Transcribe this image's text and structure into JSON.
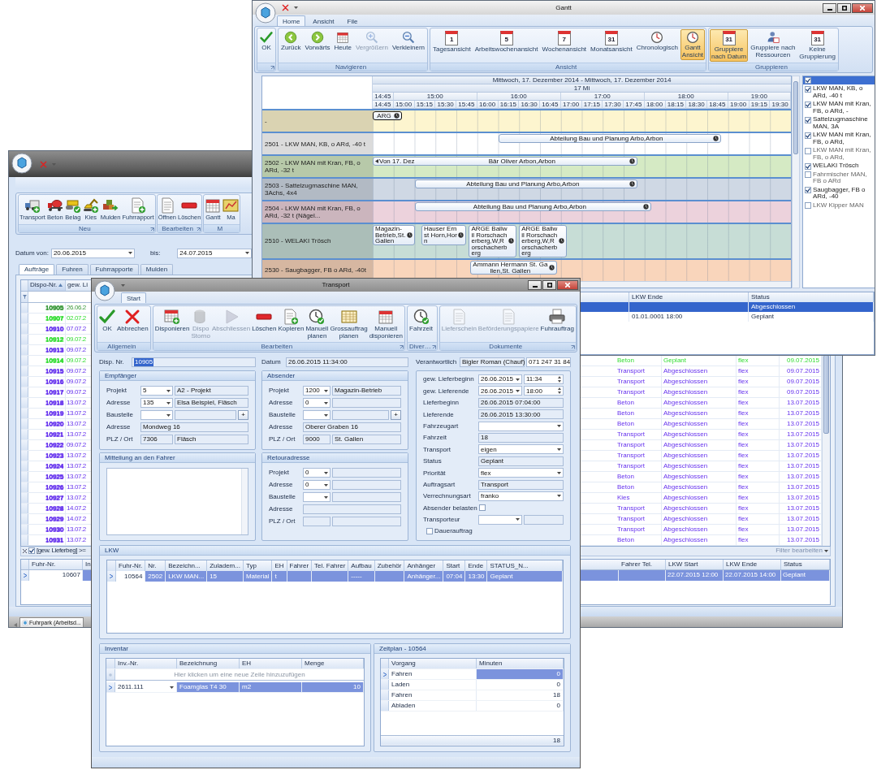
{
  "orders_window": {
    "ribbon_groups": [
      {
        "label": "Neu",
        "launcher": true,
        "buttons": [
          {
            "label": "Transport"
          },
          {
            "label": "Beton"
          },
          {
            "label": "Belag"
          },
          {
            "label": "Kies"
          },
          {
            "label": "Mulden"
          },
          {
            "label": "Fuhrrapport"
          }
        ]
      },
      {
        "label": "Bearbeiten",
        "launcher": true,
        "buttons": [
          {
            "label": "Öffnen"
          },
          {
            "label": "Löschen"
          }
        ]
      },
      {
        "label": "M",
        "launcher": false,
        "buttons": [
          {
            "label": "Gantt"
          },
          {
            "label": "Ma"
          }
        ]
      }
    ],
    "date_from": {
      "label": "Datum von:",
      "value": "20.06.2015"
    },
    "date_to": {
      "label": "bis:",
      "value": "24.07.2015"
    },
    "tabs": [
      {
        "label": "Aufträge",
        "selected": true
      },
      {
        "label": "Fuhren",
        "selected": false
      },
      {
        "label": "Fuhrrapporte",
        "selected": false
      },
      {
        "label": "Mulden",
        "selected": false
      }
    ],
    "orders_grid": {
      "columns": [
        {
          "label": "Dispo-Nr.",
          "sorted": true
        },
        {
          "label": "gew. Li",
          "sorted": false
        }
      ],
      "rows": [
        {
          "dispo_nr": "10905",
          "date": "26.06.2",
          "color": "#3c9a3c"
        },
        {
          "dispo_nr": "10907",
          "date": "02.07.2",
          "color": "#33dd33"
        },
        {
          "dispo_nr": "10910",
          "date": "07.07.2",
          "color": "#6633ee"
        },
        {
          "dispo_nr": "10912",
          "date": "09.07.2",
          "color": "#33dd33"
        },
        {
          "dispo_nr": "10913",
          "date": "09.07.2",
          "color": "#6633ee"
        },
        {
          "dispo_nr": "10914",
          "date": "09.07.2",
          "color": "#33dd33",
          "column_3": "Beton",
          "column_4": "Geplant",
          "column_5": "flex",
          "column_6": "09.07.2015"
        },
        {
          "dispo_nr": "10915",
          "date": "09.07.2",
          "color": "#6633ee",
          "column_3": "Transport",
          "column_4": "Abgeschlossen",
          "column_5": "flex",
          "column_6": "09.07.2015"
        },
        {
          "dispo_nr": "10916",
          "date": "09.07.2",
          "color": "#6633ee",
          "column_3": "Transport",
          "column_4": "Abgeschlossen",
          "column_5": "flex",
          "column_6": "09.07.2015"
        },
        {
          "dispo_nr": "10917",
          "date": "09.07.2",
          "color": "#6633ee",
          "column_3": "Transport",
          "column_4": "Abgeschlossen",
          "column_5": "flex",
          "column_6": "09.07.2015"
        },
        {
          "dispo_nr": "10918",
          "date": "13.07.2",
          "color": "#6633ee",
          "column_3": "Beton",
          "column_4": "Abgeschlossen",
          "column_5": "flex",
          "column_6": "13.07.2015"
        },
        {
          "dispo_nr": "10919",
          "date": "13.07.2",
          "color": "#6633ee",
          "column_3": "Beton",
          "column_4": "Abgeschlossen",
          "column_5": "flex",
          "column_6": "13.07.2015"
        },
        {
          "dispo_nr": "10920",
          "date": "13.07.2",
          "color": "#6633ee",
          "column_3": "Beton",
          "column_4": "Abgeschlossen",
          "column_5": "flex",
          "column_6": "13.07.2015"
        },
        {
          "dispo_nr": "10921",
          "date": "13.07.2",
          "color": "#6633ee",
          "column_3": "Transport",
          "column_4": "Abgeschlossen",
          "column_5": "flex",
          "column_6": "13.07.2015"
        },
        {
          "dispo_nr": "10922",
          "date": "09.07.2",
          "color": "#6633ee",
          "column_3": "Transport",
          "column_4": "Abgeschlossen",
          "column_5": "flex",
          "column_6": "13.07.2015"
        },
        {
          "dispo_nr": "10923",
          "date": "13.07.2",
          "color": "#6633ee",
          "column_3": "Transport",
          "column_4": "Abgeschlossen",
          "column_5": "flex",
          "column_6": "13.07.2015"
        },
        {
          "dispo_nr": "10924",
          "date": "13.07.2",
          "color": "#6633ee",
          "column_3": "Transport",
          "column_4": "Abgeschlossen",
          "column_5": "flex",
          "column_6": "13.07.2015"
        },
        {
          "dispo_nr": "10925",
          "date": "13.07.2",
          "color": "#6633ee",
          "column_3": "Beton",
          "column_4": "Abgeschlossen",
          "column_5": "flex",
          "column_6": "13.07.2015"
        },
        {
          "dispo_nr": "10926",
          "date": "13.07.2",
          "color": "#6633ee",
          "column_3": "Beton",
          "column_4": "Abgeschlossen",
          "column_5": "flex",
          "column_6": "13.07.2015"
        },
        {
          "dispo_nr": "10927",
          "date": "13.07.2",
          "color": "#6633ee",
          "column_3": "Kies",
          "column_4": "Abgeschlossen",
          "column_5": "flex",
          "column_6": "13.07.2015"
        },
        {
          "dispo_nr": "10928",
          "date": "14.07.2",
          "color": "#6633ee",
          "column_3": "Transport",
          "column_4": "Abgeschlossen",
          "column_5": "flex",
          "column_6": "13.07.2015"
        },
        {
          "dispo_nr": "10929",
          "date": "14.07.2",
          "color": "#6633ee",
          "column_3": "Transport",
          "column_4": "Abgeschlossen",
          "column_5": "flex",
          "column_6": "13.07.2015"
        },
        {
          "dispo_nr": "10930",
          "date": "13.07.2",
          "color": "#6633ee",
          "column_3": "Transport",
          "column_4": "Abgeschlossen",
          "column_5": "flex",
          "column_6": "13.07.2015"
        },
        {
          "dispo_nr": "10931",
          "date": "13.07.2",
          "color": "#6633ee",
          "column_3": "Beton",
          "column_4": "Abgeschlossen",
          "column_5": "flex",
          "column_6": "13.07.2015"
        }
      ]
    },
    "filter": {
      "enabled": true,
      "text": "[gew. Lieferbeg] >=",
      "edit_link": "Filter bearbeiten"
    },
    "rides_grid": {
      "columns": [
        "Fuhr-Nr.",
        "In",
        "Fahrer Tel.",
        "LKW Start",
        "LKW Ende",
        "Status"
      ],
      "rows": [
        {
          "fuhr_nr": "10607",
          "lkw_start": "22.07.2015 12:00",
          "lkw_ende": "22.07.2015 14:00",
          "status": "Geplant",
          "selected": true
        }
      ]
    },
    "document_tab": {
      "label": "Fuhrpark (Arbeitsd...",
      "selected": true
    }
  },
  "gantt_window": {
    "title": "Gantt",
    "tabs": [
      {
        "label": "Home",
        "selected": true
      },
      {
        "label": "Ansicht",
        "selected": false
      },
      {
        "label": "File",
        "selected": false
      }
    ],
    "ribbon_groups": [
      {
        "launcher": true,
        "buttons": [
          {
            "label": "OK",
            "selected": false,
            "disabled": false
          }
        ]
      },
      {
        "label": "Navigieren",
        "launcher": false,
        "buttons": [
          {
            "label": "Zurück",
            "selected": false,
            "disabled": false
          },
          {
            "label": "Vorwärts",
            "selected": false,
            "disabled": false
          },
          {
            "label": "Heute",
            "selected": false,
            "disabled": false
          },
          {
            "label": "Vergrößern",
            "selected": false,
            "disabled": true
          },
          {
            "label": "Verkleinern",
            "selected": false,
            "disabled": false
          }
        ]
      },
      {
        "label": "Ansicht",
        "launcher": false,
        "buttons": [
          {
            "label": "Tagesansicht",
            "icon_text": "1",
            "selected": false,
            "disabled": false
          },
          {
            "label": "Arbeitswochenansicht",
            "icon_text": "5",
            "selected": false,
            "disabled": false
          },
          {
            "label": "Wochenansicht",
            "icon_text": "7",
            "selected": false,
            "disabled": false
          },
          {
            "label": "Monatsansicht",
            "icon_text": "31",
            "selected": false,
            "disabled": false
          },
          {
            "label": "Chronologisch",
            "selected": false,
            "disabled": false
          },
          {
            "label": "Gantt\nAnsicht",
            "selected": true,
            "disabled": false
          }
        ]
      },
      {
        "label": "Gruppieren",
        "launcher": false,
        "buttons": [
          {
            "label": "Gruppiere\nnach Datum",
            "icon_text": "31",
            "selected": true,
            "disabled": false
          },
          {
            "label": "Gruppiere nach\nRessourcen",
            "selected": false,
            "disabled": false
          },
          {
            "label": "Keine\nGruppierung",
            "icon_text": "31",
            "selected": false,
            "disabled": false
          }
        ]
      }
    ],
    "scheduler": {
      "date_range": "Mittwoch, 17. Dezember 2014 - Mittwoch, 17. Dezember 2014",
      "day": "17 Mi",
      "hours": [
        "14:45",
        "15:00",
        "16:00",
        "17:00",
        "18:00",
        "19:00"
      ],
      "slots": [
        "14:45",
        "15:00",
        "15:15",
        "15:30",
        "15:45",
        "16:00",
        "16:15",
        "16:30",
        "16:45",
        "17:00",
        "17:15",
        "17:30",
        "17:45",
        "18:00",
        "18:15",
        "18:30",
        "18:45",
        "19:00",
        "19:15",
        "19:30"
      ],
      "resources": [
        {
          "label": "-",
          "color": "#fdf5cf",
          "appointments": [
            {
              "text": "ARG",
              "selected": true
            }
          ]
        },
        {
          "label": "2501 - LKW MAN, KB, o ARd, -40 t",
          "color": "#ffffff",
          "appointments": [
            {
              "text": "Abteilung Bau und Planung Arbo,Arbon",
              "selected": false
            }
          ]
        },
        {
          "label": "2502 - LKW MAN mit Kran, FB, o ARd, -32 t",
          "color": "#d5eac4",
          "appointments": [
            {
              "prefix": "Von 17. Dez",
              "text": "Bär Oliver Arbon,Arbon",
              "selected": false
            }
          ]
        },
        {
          "label": "2503 - Sattelzugmaschine MAN, 3Achs, 4x4",
          "color": "#cfd8e4",
          "appointments": [
            {
              "text": "Abteilung Bau und Planung Arbo,Arbon",
              "selected": false
            }
          ]
        },
        {
          "label": "2504 - LKW MAN mit Kran, FB, o ARd, -32 t (Nägel...",
          "color": "#ecd2dc",
          "appointments": [
            {
              "text": "Abteilung Bau und Planung Arbo,Arbon",
              "selected": false
            }
          ]
        },
        {
          "label": "2510 - WELAKI Trösch",
          "color": "#c7ddd6",
          "appointments": [
            {
              "text": "Magazin-Betrieb,St. Gallen",
              "selected": false
            },
            {
              "text": "Hauser Ernst Horn,Horn",
              "selected": false
            },
            {
              "text": "ARGE Ballwil Rorschacherberg,W,Rorschacherberg",
              "selected": false
            },
            {
              "text": "ARGE Ballwil Rorschacherberg,W,Rorschacherberg",
              "selected": false
            }
          ]
        },
        {
          "label": "2530 - Saugbagger, FB o ARd, -40t",
          "color": "#f9d5bb",
          "appointments": [
            {
              "text": "Ammann Hermann St. Gallen,St. Gallen",
              "selected": false
            }
          ]
        }
      ]
    },
    "resource_filter": {
      "all_checked": true,
      "items": [
        {
          "label": "LKW MAN, KB, o ARd, -40 t",
          "checked": true
        },
        {
          "label": "LKW MAN mit Kran, FB, o ARd, -",
          "checked": true
        },
        {
          "label": "Sattelzugmaschine MAN, 3A",
          "checked": true
        },
        {
          "label": "LKW MAN mit Kran, FB, o ARd,",
          "checked": true
        },
        {
          "label": "LKW MAN mit Kran, FB, o ARd,",
          "checked": false
        },
        {
          "label": "WELAKI Trösch",
          "checked": true
        },
        {
          "label": "Fahrmischer MAN, FB o ARd",
          "checked": false
        },
        {
          "label": "Saugbagger, FB o ARd, -40",
          "checked": true
        },
        {
          "label": "LKW Kipper MAN",
          "checked": false
        }
      ]
    },
    "lower_grid": {
      "columns": [
        "LKW Ende",
        "Status"
      ],
      "rows": [
        {
          "status": "Abgeschlossen",
          "selected": true
        },
        {
          "lkw_ende": "01.01.0001 18:00",
          "status": "Geplant",
          "selected": false
        }
      ]
    }
  },
  "transport_window": {
    "title": "Transport",
    "tabs": [
      {
        "label": "Start",
        "selected": true
      }
    ],
    "ribbon_groups": [
      {
        "label": "Allgemein",
        "launcher": false,
        "buttons": [
          {
            "label": "OK",
            "disabled": false
          },
          {
            "label": "Abbrechen",
            "disabled": false
          }
        ]
      },
      {
        "label": "Bearbeiten",
        "launcher": true,
        "buttons": [
          {
            "label": "Disponieren",
            "disabled": false
          },
          {
            "label": "Dispo\nStorno",
            "disabled": true
          },
          {
            "label": "Abschliessen",
            "disabled": true
          },
          {
            "label": "Löschen",
            "disabled": false
          },
          {
            "label": "Kopieren",
            "disabled": false
          },
          {
            "label": "Manuell\nplanen",
            "disabled": false
          },
          {
            "label": "Grossauftrag\nplanen",
            "disabled": false
          },
          {
            "label": "Manuell\ndisponieren",
            "disabled": false
          }
        ]
      },
      {
        "label": "Diver…",
        "launcher": true,
        "buttons": [
          {
            "label": "Fahrzeit",
            "disabled": false
          }
        ]
      },
      {
        "label": "Dokumente",
        "launcher": true,
        "buttons": [
          {
            "label": "Lieferschein",
            "disabled": true
          },
          {
            "label": "Beförderungspapiere",
            "disabled": true
          },
          {
            "label": "Fuhrauftrag",
            "disabled": false
          }
        ]
      }
    ],
    "disp_nr": {
      "label": "Disp. Nr.",
      "value": "10905",
      "highlighted": true
    },
    "datum": {
      "label": "Datum",
      "value": "26.06.2015 11:34:00"
    },
    "verantwortlich": {
      "label": "Verantwortlich",
      "value": "Bigler Roman (Chauf)",
      "phone": "071 247 31 84"
    },
    "empfaenger": {
      "title": "Empfänger",
      "rows": [
        {
          "kind": "combo",
          "label": "Projekt",
          "value": "5",
          "text": "A2 - Projekt"
        },
        {
          "kind": "combo",
          "label": "Adresse",
          "value": "135",
          "text": "Elsa Beispiel, Fläsch"
        },
        {
          "kind": "combo_add",
          "label": "Baustelle",
          "add": "+"
        },
        {
          "kind": "text",
          "label": "Adresse",
          "value": "Mondweg 16"
        },
        {
          "kind": "split",
          "label": "PLZ / Ort",
          "value": "7306",
          "text": "Fläsch"
        }
      ]
    },
    "absender": {
      "title": "Absender",
      "rows": [
        {
          "kind": "combo",
          "label": "Projekt",
          "value": "1200",
          "text": "Magazin-Betrieb"
        },
        {
          "kind": "combo",
          "label": "Adresse",
          "value": "0"
        },
        {
          "kind": "combo_add",
          "label": "Baustelle",
          "add": "+"
        },
        {
          "kind": "text",
          "label": "Adresse",
          "value": "Oberer Graben 16"
        },
        {
          "kind": "split",
          "label": "PLZ / Ort",
          "value": "9000",
          "text": "St. Gallen"
        }
      ]
    },
    "mitteilung": {
      "title": "Mitteilung an den Fahrer"
    },
    "retouradresse": {
      "title": "Retouradresse",
      "rows": [
        {
          "kind": "combo",
          "label": "Projekt",
          "value": "0"
        },
        {
          "kind": "combo",
          "label": "Adresse",
          "value": "0"
        },
        {
          "kind": "combo",
          "label": "Baustelle"
        },
        {
          "kind": "text",
          "label": "Adresse"
        },
        {
          "kind": "split",
          "label": "PLZ / Ort"
        }
      ]
    },
    "details": [
      {
        "kind": "date_time",
        "label": "gew. Lieferbeginn",
        "date": "26.06.2015",
        "time": "11:34"
      },
      {
        "kind": "date_time",
        "label": "gew. Lieferende",
        "date": "26.06.2015",
        "time": "18:00"
      },
      {
        "kind": "text",
        "label": "Lieferbeginn",
        "value": "26.06.2015 07:04:00"
      },
      {
        "kind": "text",
        "label": "Lieferende",
        "value": "26.06.2015 13:30:00"
      },
      {
        "kind": "combo",
        "label": "Fahrzeugart"
      },
      {
        "kind": "text",
        "label": "Fahrzeit",
        "value": "18"
      },
      {
        "kind": "combo",
        "label": "Transport",
        "value": "eigen"
      },
      {
        "kind": "text",
        "label": "Status",
        "value": "Geplant"
      },
      {
        "kind": "combo",
        "label": "Priorität",
        "value": "flex"
      },
      {
        "kind": "text",
        "label": "Auftragsart",
        "value": "Transport"
      },
      {
        "kind": "combo",
        "label": "Verrechnungsart",
        "value": "franko"
      },
      {
        "kind": "checkbox",
        "label": "Absender belasten",
        "checked": false
      },
      {
        "kind": "combo_text",
        "label": "Transporteur"
      },
      {
        "kind": "checkbox_after",
        "label": "Dauerauftrag",
        "checked": false
      }
    ],
    "lkw": {
      "title": "LKW",
      "columns": [
        "Fuhr-Nr.",
        "Nr.",
        "Bezeichn...",
        "Zuladem...",
        "Typ",
        "EH",
        "Fahrer",
        "Tel. Fahrer",
        "Aufbau",
        "Zubehör",
        "Anhänger",
        "Start",
        "Ende",
        "STATUS_N..."
      ],
      "rows": [
        {
          "fuhr_nr": "10564",
          "nr": "2502",
          "bezeichnung": "LKW MAN...",
          "zuladung": "15",
          "typ": "Material",
          "eh": "t",
          "aufbau": "-----",
          "anhaenger": "Anhänger...",
          "start": "07:04",
          "ende": "13:30",
          "status": "Geplant",
          "selected": true
        }
      ]
    },
    "inventar": {
      "title": "Inventar",
      "columns": [
        "Inv.-Nr.",
        "Bezeichnung",
        "EH",
        "Menge"
      ],
      "new_row_hint": "Hier klicken um eine neue Zeile hinzuzufügen",
      "rows": [
        {
          "inv_nr": "2611.111",
          "bezeichnung": "Foamglas T4 30",
          "eh": "m2",
          "menge": "10",
          "selected": true
        }
      ]
    },
    "zeitplan": {
      "title": "Zeitplan - 10564",
      "columns": [
        "Vorgang",
        "Minuten"
      ],
      "rows": [
        {
          "vorgang": "Fahren",
          "minuten": "0",
          "selected": true
        },
        {
          "vorgang": "Laden",
          "minuten": "0",
          "selected": false
        },
        {
          "vorgang": "Fahren",
          "minuten": "18",
          "selected": false
        },
        {
          "vorgang": "Abladen",
          "minuten": "0",
          "selected": false
        }
      ],
      "total": "18"
    }
  }
}
